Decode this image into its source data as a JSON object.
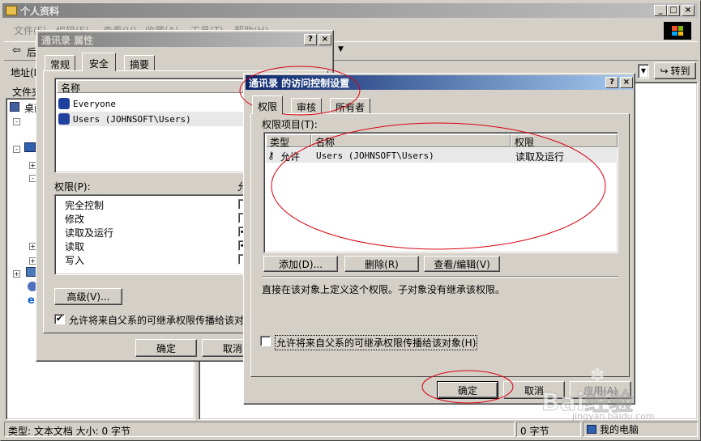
{
  "explorer": {
    "title": "个人资料",
    "menu": [
      "文件(F)",
      "编辑(E)",
      "查看(V)",
      "收藏(A)",
      "工具(T)",
      "帮助(H)"
    ],
    "back_label": "后",
    "address_label": "地址(D)",
    "go_label": "转到",
    "folders_label": "文件夹",
    "desktop_label": "桌面",
    "status_left": "类型: 文本文档 大小: 0 字节",
    "status_size": "0 字节",
    "status_zone": "我的电脑"
  },
  "props": {
    "title": "通讯录 属性",
    "tabs": [
      "常规",
      "安全",
      "摘要"
    ],
    "active_tab": "安全",
    "name_header": "名称",
    "users": [
      "Everyone",
      "Users (JOHNSOFT\\Users)"
    ],
    "perm_label": "权限(P):",
    "perm_col": "允",
    "perms": [
      "完全控制",
      "修改",
      "读取及运行",
      "读取",
      "写入"
    ],
    "perm_checks": [
      "",
      "",
      "✔",
      "✔",
      ""
    ],
    "advanced_btn": "高级(V)...",
    "inherit_text": "允许将来自父系的可继承权限传播给该对",
    "ok": "确定",
    "cancel": "取消"
  },
  "acl": {
    "title": "通讯录 的访问控制设置",
    "tabs": [
      "权限",
      "审核",
      "所有者"
    ],
    "entries_label": "权限项目(T):",
    "columns": [
      "类型",
      "名称",
      "权限"
    ],
    "rows": [
      {
        "type": "允许",
        "name": "Users (JOHNSOFT\\Users)",
        "perm": "读取及运行"
      }
    ],
    "add_btn": "添加(D)...",
    "remove_btn": "删除(R)",
    "view_btn": "查看/编辑(V)",
    "note": "直接在该对象上定义这个权限。子对象没有继承该权限。",
    "inherit_text": "允许将来自父系的可继承权限传播给该对象(H)",
    "ok": "确定",
    "cancel": "取消",
    "apply": "应用(A)"
  },
  "watermark": {
    "brand": "Bai经验",
    "url": "jingyan.baidu.com"
  },
  "colors": {
    "active_title": "#0a246a",
    "face": "#d4d0c8",
    "annotation": "#d9000f"
  }
}
